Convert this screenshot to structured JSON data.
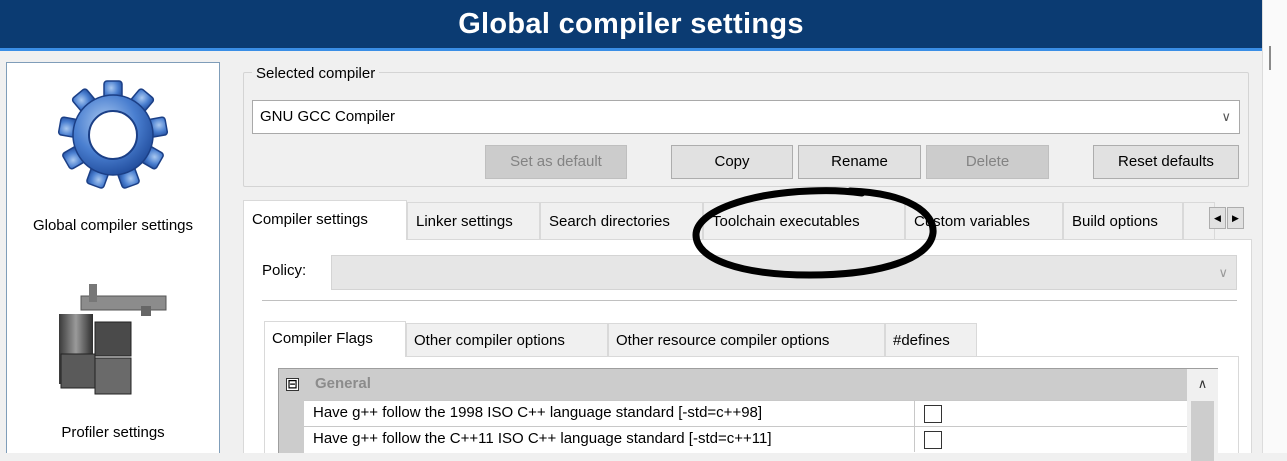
{
  "window": {
    "title": "Global compiler settings"
  },
  "sidebar": {
    "items": [
      {
        "label": "Global compiler settings",
        "icon": "gear-icon"
      },
      {
        "label": "Profiler settings",
        "icon": "caliper-icon"
      }
    ]
  },
  "compiler_group": {
    "label": "Selected compiler",
    "selected_value": "GNU GCC Compiler",
    "buttons": {
      "set_default": "Set as default",
      "copy": "Copy",
      "rename": "Rename",
      "delete": "Delete",
      "reset": "Reset defaults"
    }
  },
  "tabs": [
    {
      "label": "Compiler settings",
      "active": true
    },
    {
      "label": "Linker settings"
    },
    {
      "label": "Search directories"
    },
    {
      "label": "Toolchain executables"
    },
    {
      "label": "Custom variables"
    },
    {
      "label": "Build options"
    }
  ],
  "policy": {
    "label": "Policy:",
    "value": ""
  },
  "inner_tabs": [
    {
      "label": "Compiler Flags",
      "active": true
    },
    {
      "label": "Other compiler options"
    },
    {
      "label": "Other resource compiler options"
    },
    {
      "label": "#defines"
    }
  ],
  "property_grid": {
    "category_toggle": "⊟",
    "category": "General",
    "rows": [
      {
        "label": "Have g++ follow the 1998 ISO C++ language standard  [-std=c++98]",
        "checked": false
      },
      {
        "label": "Have g++ follow the C++11 ISO C++ language standard  [-std=c++11]",
        "checked": false
      }
    ]
  },
  "colors": {
    "title_bar": "#0b3b72",
    "annotation_ellipse": "#000000"
  }
}
